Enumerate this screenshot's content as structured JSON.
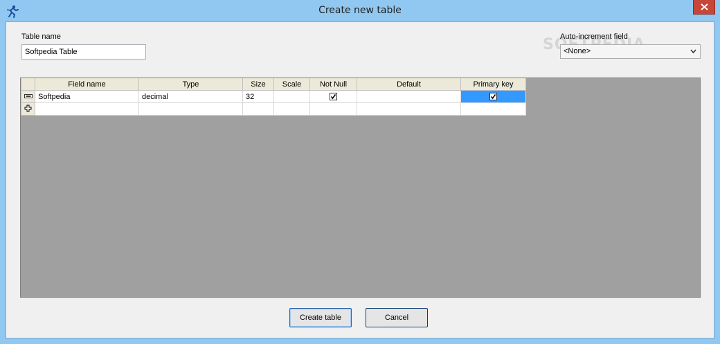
{
  "window": {
    "title": "Create new table"
  },
  "form": {
    "table_name_label": "Table name",
    "table_name_value": "Softpedia Table",
    "auto_increment_label": "Auto-increment field",
    "auto_increment_value": "<None>"
  },
  "grid": {
    "columns": [
      "Field name",
      "Type",
      "Size",
      "Scale",
      "Not Null",
      "Default",
      "Primary key"
    ],
    "rows": [
      {
        "field_name": "Softpedia",
        "type": "decimal",
        "size": "32",
        "scale": "",
        "not_null": true,
        "default": "",
        "primary_key": true
      }
    ]
  },
  "buttons": {
    "create_label": "Create table",
    "cancel_label": "Cancel"
  },
  "watermark": "SOFTPEDIA",
  "colors": {
    "titlebar": "#91c8f2",
    "close_button": "#c7463a",
    "selection": "#3399ff",
    "grid_background": "#a0a0a0"
  }
}
